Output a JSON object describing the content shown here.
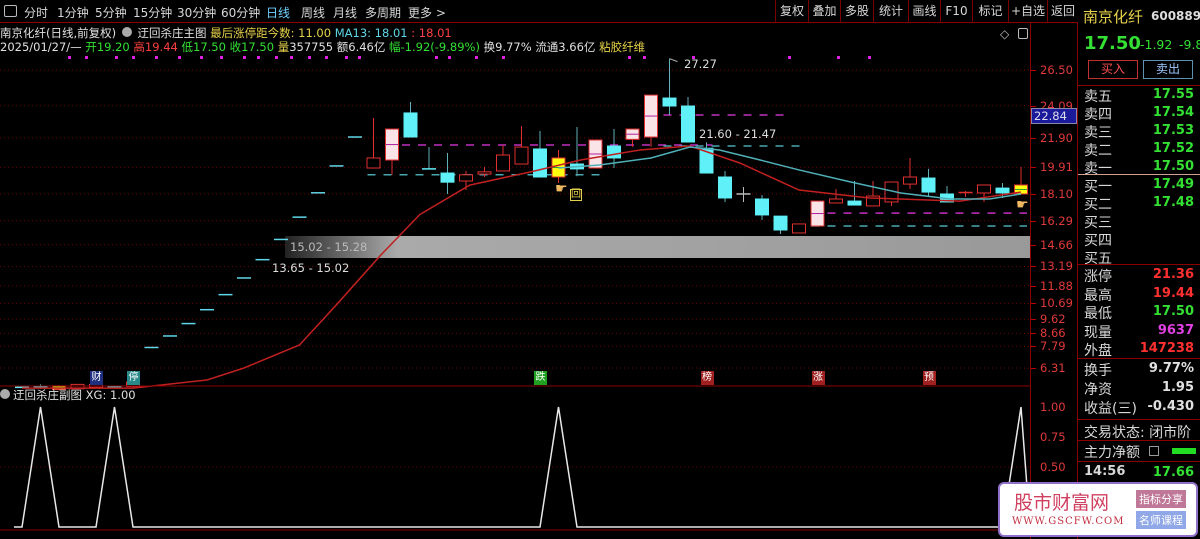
{
  "toolbar": {
    "periods": [
      "分时",
      "1分钟",
      "5分钟",
      "15分钟",
      "30分钟",
      "60分钟",
      "日线",
      "周线",
      "月线",
      "多周期",
      "更多 >"
    ],
    "active_period": "日线",
    "right_buttons": [
      "复权",
      "叠加",
      "多股",
      "统计",
      "画线",
      "F10",
      "标记",
      "+自选",
      "返回"
    ]
  },
  "header": {
    "stock_title": "南京化纤(日线,前复权)",
    "indicator_name": "迂回杀庄主图",
    "last_limit_label": "最后涨停距今数: 11.00",
    "ma13_label": "MA13: 18.01",
    "ma_other": ": 18.01",
    "date": "2025/01/27/—",
    "open_label": "开",
    "open": "19.20",
    "high_label": "高",
    "high": "19.44",
    "low_label": "低",
    "low": "17.50",
    "close_label": "收",
    "close": "17.50",
    "vol_label": "量",
    "vol": "357755",
    "amount": "额6.46亿",
    "change_label": "幅",
    "change": "-1.92(-9.89%)",
    "turnover": "换9.77%",
    "float_cap": "流通3.66亿",
    "sector": "粘胶纤维"
  },
  "chart_data": {
    "type": "candlestick",
    "y_ticks": [
      "26.50",
      "24.09",
      "21.90",
      "19.91",
      "18.10",
      "16.29",
      "14.66",
      "13.19",
      "11.88",
      "10.69",
      "9.62",
      "8.66",
      "7.79",
      "6.31"
    ],
    "y_tick_values": [
      26.5,
      24.09,
      21.9,
      19.91,
      18.1,
      16.29,
      14.66,
      13.19,
      11.88,
      10.69,
      9.62,
      8.66,
      7.79,
      6.31
    ],
    "current_price_tag": "22.84",
    "high_annotation": "27.27",
    "range_labels": [
      "21.60 - 21.47",
      "15.02 - 15.28",
      "13.65 - 15.02"
    ],
    "candles": [
      {
        "o": 5.0,
        "h": 5.05,
        "l": 5.0,
        "c": 5.0,
        "s": "c"
      },
      {
        "o": 5.05,
        "h": 5.2,
        "l": 4.9,
        "c": 5.0,
        "s": "c"
      },
      {
        "o": 5.1,
        "h": 5.15,
        "l": 4.8,
        "c": 4.85,
        "s": "y"
      },
      {
        "o": 4.9,
        "h": 5.2,
        "l": 4.85,
        "c": 5.2,
        "s": "r"
      },
      {
        "o": 5.0,
        "h": 5.2,
        "l": 5.0,
        "c": 5.2,
        "s": "r"
      },
      {
        "o": 5.05,
        "h": 5.1,
        "l": 5.0,
        "c": 5.0,
        "s": "c"
      },
      {
        "o": 5.05,
        "h": 5.5,
        "l": 5.0,
        "c": 5.35,
        "s": "r"
      },
      {
        "o": 7.7,
        "h": 7.7,
        "l": 7.7,
        "c": 7.7,
        "s": "f"
      },
      {
        "o": 8.48,
        "h": 8.48,
        "l": 8.48,
        "c": 8.48,
        "s": "f"
      },
      {
        "o": 9.32,
        "h": 9.32,
        "l": 9.32,
        "c": 9.32,
        "s": "f"
      },
      {
        "o": 10.26,
        "h": 10.26,
        "l": 10.26,
        "c": 10.26,
        "s": "f"
      },
      {
        "o": 11.28,
        "h": 11.28,
        "l": 11.28,
        "c": 11.28,
        "s": "f"
      },
      {
        "o": 12.41,
        "h": 12.41,
        "l": 12.41,
        "c": 12.41,
        "s": "f"
      },
      {
        "o": 13.65,
        "h": 13.65,
        "l": 13.65,
        "c": 13.65,
        "s": "f"
      },
      {
        "o": 15.02,
        "h": 15.02,
        "l": 15.02,
        "c": 15.02,
        "s": "f"
      },
      {
        "o": 16.53,
        "h": 16.53,
        "l": 16.53,
        "c": 16.53,
        "s": "f"
      },
      {
        "o": 18.18,
        "h": 18.18,
        "l": 18.18,
        "c": 18.18,
        "s": "f"
      },
      {
        "o": 20.0,
        "h": 20.0,
        "l": 20.0,
        "c": 20.0,
        "s": "f"
      },
      {
        "o": 21.96,
        "h": 21.96,
        "l": 21.96,
        "c": 21.96,
        "s": "f"
      },
      {
        "o": 19.86,
        "h": 23.25,
        "l": 19.86,
        "c": 20.54,
        "s": "r"
      },
      {
        "o": 20.4,
        "h": 22.5,
        "l": 19.4,
        "c": 22.5,
        "s": "p"
      },
      {
        "o": 23.59,
        "h": 24.33,
        "l": 21.96,
        "c": 21.96,
        "s": "c"
      },
      {
        "o": 19.8,
        "h": 21.28,
        "l": 19.8,
        "c": 19.8,
        "s": "c"
      },
      {
        "o": 19.52,
        "h": 20.88,
        "l": 18.1,
        "c": 18.9,
        "s": "c"
      },
      {
        "o": 18.98,
        "h": 19.66,
        "l": 18.37,
        "c": 19.4,
        "s": "r"
      },
      {
        "o": 19.45,
        "h": 19.93,
        "l": 19.25,
        "c": 19.6,
        "s": "r"
      },
      {
        "o": 19.66,
        "h": 21.42,
        "l": 19.66,
        "c": 20.74,
        "s": "r"
      },
      {
        "o": 20.13,
        "h": 22.7,
        "l": 20.13,
        "c": 21.28,
        "s": "r"
      },
      {
        "o": 21.15,
        "h": 22.37,
        "l": 19.25,
        "c": 19.25,
        "s": "c"
      },
      {
        "o": 20.54,
        "h": 21.08,
        "l": 18.84,
        "c": 19.25,
        "s": "y"
      },
      {
        "o": 20.13,
        "h": 22.64,
        "l": 19.3,
        "c": 19.8,
        "s": "c"
      },
      {
        "o": 19.86,
        "h": 21.76,
        "l": 19.86,
        "c": 21.76,
        "s": "p"
      },
      {
        "o": 21.35,
        "h": 22.5,
        "l": 19.86,
        "c": 20.54,
        "s": "c"
      },
      {
        "o": 21.8,
        "h": 22.5,
        "l": 21.3,
        "c": 22.5,
        "s": "p"
      },
      {
        "o": 21.96,
        "h": 24.8,
        "l": 21.28,
        "c": 24.8,
        "s": "p"
      },
      {
        "o": 24.6,
        "h": 27.27,
        "l": 23.45,
        "c": 24.06,
        "s": "c"
      },
      {
        "o": 24.06,
        "h": 24.67,
        "l": 21.62,
        "c": 21.62,
        "s": "c"
      },
      {
        "o": 21.2,
        "h": 21.6,
        "l": 19.52,
        "c": 19.52,
        "s": "c"
      },
      {
        "o": 19.25,
        "h": 19.66,
        "l": 17.56,
        "c": 17.83,
        "s": "c"
      },
      {
        "o": 18.1,
        "h": 18.57,
        "l": 17.56,
        "c": 18.1,
        "s": "x"
      },
      {
        "o": 17.76,
        "h": 18.03,
        "l": 16.34,
        "c": 16.68,
        "s": "c"
      },
      {
        "o": 16.6,
        "h": 16.6,
        "l": 15.39,
        "c": 15.66,
        "s": "c"
      },
      {
        "o": 15.46,
        "h": 16.07,
        "l": 15.46,
        "c": 16.07,
        "s": "r"
      },
      {
        "o": 15.93,
        "h": 17.62,
        "l": 15.93,
        "c": 17.62,
        "s": "p"
      },
      {
        "o": 17.49,
        "h": 18.44,
        "l": 17.49,
        "c": 17.76,
        "s": "r"
      },
      {
        "o": 17.62,
        "h": 18.98,
        "l": 17.35,
        "c": 17.35,
        "s": "c"
      },
      {
        "o": 17.29,
        "h": 18.98,
        "l": 17.29,
        "c": 17.96,
        "s": "r"
      },
      {
        "o": 17.56,
        "h": 18.91,
        "l": 17.29,
        "c": 18.91,
        "s": "r"
      },
      {
        "o": 18.77,
        "h": 20.54,
        "l": 18.44,
        "c": 19.25,
        "s": "r"
      },
      {
        "o": 19.18,
        "h": 19.8,
        "l": 17.9,
        "c": 18.23,
        "s": "c"
      },
      {
        "o": 18.1,
        "h": 18.64,
        "l": 17.56,
        "c": 17.56,
        "s": "c"
      },
      {
        "o": 18.1,
        "h": 18.3,
        "l": 17.9,
        "c": 18.2,
        "s": "r"
      },
      {
        "o": 18.17,
        "h": 18.71,
        "l": 17.56,
        "c": 18.71,
        "s": "r"
      },
      {
        "o": 18.5,
        "h": 18.84,
        "l": 17.83,
        "c": 18.17,
        "s": "c"
      },
      {
        "o": 18.71,
        "h": 19.93,
        "l": 18.1,
        "c": 18.1,
        "s": "y"
      }
    ],
    "ma_long": [
      [
        0,
        4.95
      ],
      [
        6,
        4.95
      ],
      [
        10,
        5.5
      ],
      [
        12,
        6.31
      ],
      [
        15,
        7.87
      ],
      [
        17,
        10.6
      ],
      [
        19.4,
        13.97
      ],
      [
        21.5,
        16.7
      ],
      [
        24.2,
        18.7
      ],
      [
        27.5,
        19.6
      ],
      [
        30.2,
        20.4
      ],
      [
        33.4,
        21.08
      ],
      [
        36.1,
        21.35
      ],
      [
        38.8,
        20.2
      ],
      [
        42,
        18.37
      ],
      [
        45.8,
        17.83
      ],
      [
        50.7,
        17.62
      ],
      [
        54,
        18.23
      ]
    ],
    "ma13": [
      [
        29,
        19.86
      ],
      [
        31.2,
        20.06
      ],
      [
        34,
        20.54
      ],
      [
        36.1,
        21.28
      ],
      [
        37.7,
        21.08
      ],
      [
        39.9,
        20.4
      ],
      [
        42,
        19.73
      ],
      [
        44.8,
        18.91
      ],
      [
        47.5,
        18.17
      ],
      [
        50.2,
        17.76
      ],
      [
        52.3,
        17.76
      ],
      [
        54,
        18.1
      ]
    ],
    "dashed_levels": [
      {
        "price": 21.42,
        "from": 20,
        "to": 37,
        "color": "#c030c0"
      },
      {
        "price": 23.45,
        "from": 35,
        "to": 41,
        "color": "#c030c0"
      },
      {
        "price": 19.4,
        "from": 19,
        "to": 31,
        "color": "#4aa8b0"
      },
      {
        "price": 21.35,
        "from": 35,
        "to": 42,
        "color": "#4aa8b0"
      },
      {
        "price": 16.8,
        "from": 43,
        "to": 54,
        "color": "#c030c0"
      },
      {
        "price": 15.93,
        "from": 43,
        "to": 54,
        "color": "#4aa8b0"
      }
    ],
    "signal_markers": [
      {
        "i": 4,
        "text": "财",
        "color": "#203080"
      },
      {
        "i": 6,
        "text": "停",
        "color": "#2a8a8a"
      },
      {
        "i": 28,
        "text": "跌",
        "color": "#20a020"
      },
      {
        "i": 37,
        "text": "榜",
        "color": "#a02020"
      },
      {
        "i": 43,
        "text": "涨",
        "color": "#a02020"
      },
      {
        "i": 49,
        "text": "预",
        "color": "#a02020"
      }
    ],
    "hand_icon_label": "回"
  },
  "sub_chart": {
    "title": "迂回杀庄副图",
    "xg_label": "XG: 1.00",
    "y_ticks": [
      "1.00",
      "0.75",
      "0.50"
    ],
    "xg_values": [
      0,
      1,
      0,
      0,
      0,
      1,
      0,
      0,
      0,
      0,
      0,
      0,
      0,
      0,
      0,
      0,
      0,
      0,
      0,
      0,
      0,
      0,
      0,
      0,
      0,
      0,
      0,
      0,
      0,
      1,
      0,
      0,
      0,
      0,
      0,
      0,
      0,
      0,
      0,
      0,
      0,
      0,
      0,
      0,
      0,
      0,
      0,
      0,
      0,
      0,
      0,
      0,
      0,
      0,
      1
    ]
  },
  "right_panel": {
    "name": "南京化纤",
    "code": "600889",
    "price": "17.50",
    "change": "-1.92",
    "change_pct": "-9.8",
    "buy_button": "买入",
    "sell_button": "卖出",
    "asks": [
      {
        "label": "卖五",
        "price": "17.55"
      },
      {
        "label": "卖四",
        "price": "17.54"
      },
      {
        "label": "卖三",
        "price": "17.53"
      },
      {
        "label": "卖二",
        "price": "17.52"
      },
      {
        "label": "卖一",
        "price": "17.50"
      }
    ],
    "bids": [
      {
        "label": "买一",
        "price": "17.49"
      },
      {
        "label": "买二",
        "price": "17.48"
      },
      {
        "label": "买三",
        "price": ""
      },
      {
        "label": "买四",
        "price": ""
      },
      {
        "label": "买五",
        "price": ""
      }
    ],
    "stats": [
      {
        "label": "涨停",
        "value": "21.36",
        "color": "#ff3030"
      },
      {
        "label": "最高",
        "value": "19.44",
        "color": "#ff3030"
      },
      {
        "label": "最低",
        "value": "17.50",
        "color": "#33e033"
      },
      {
        "label": "现量",
        "value": "9637",
        "color": "#e040e0"
      },
      {
        "label": "外盘",
        "value": "147238",
        "color": "#ff3030"
      }
    ],
    "stats2": [
      {
        "label": "换手",
        "value": "9.77%"
      },
      {
        "label": "净资",
        "value": "1.95"
      },
      {
        "label": "收益(三)",
        "value": "-0.430"
      }
    ],
    "trade_status": "交易状态: 闭市阶",
    "main_net": "主力净额",
    "tick_time": "14:56",
    "tick_price": "17.66"
  },
  "watermark": {
    "title": "股市财富网",
    "url": "WWW.GSCFW.COM",
    "btn1": "指标分享",
    "btn2": "名师课程"
  }
}
